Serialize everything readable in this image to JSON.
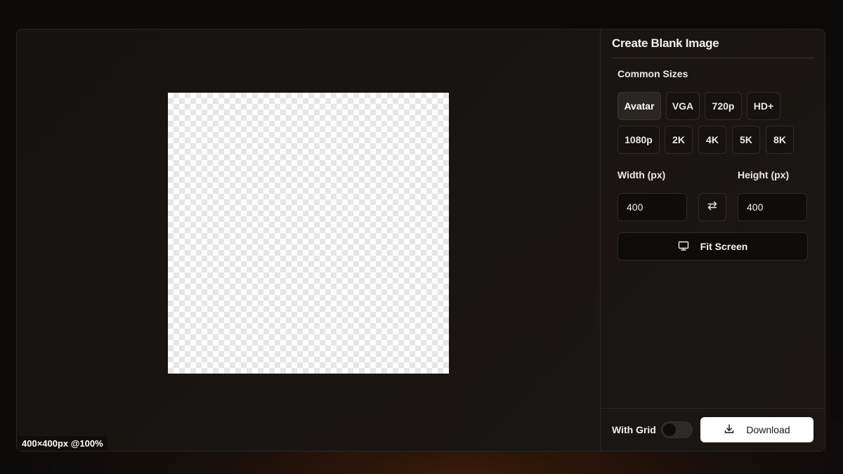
{
  "panel": {
    "title": "Create Blank Image",
    "common_sizes_label": "Common Sizes",
    "sizes": [
      "Avatar",
      "VGA",
      "720p",
      "HD+",
      "1080p",
      "2K",
      "4K",
      "5K",
      "8K"
    ],
    "active_size": "Avatar",
    "width_label": "Width (px)",
    "height_label": "Height (px)",
    "width_value": "400",
    "height_value": "400",
    "swap_icon": "swap-arrows-icon",
    "fit_label": "Fit Screen",
    "fit_icon": "monitor-icon"
  },
  "footer": {
    "grid_label": "With Grid",
    "grid_enabled": false,
    "download_label": "Download",
    "download_icon": "download-icon"
  },
  "canvas": {
    "status": "400×400px @100%"
  },
  "colors": {
    "accent": "#ffffff",
    "background": "#0c0b0a",
    "panel": "#1b1613"
  }
}
